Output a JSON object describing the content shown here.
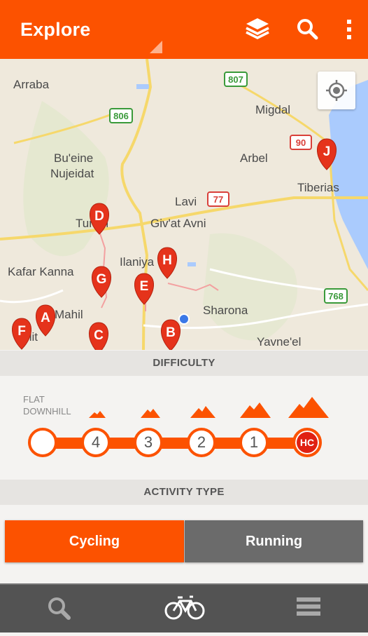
{
  "appbar": {
    "title": "Explore",
    "icons": [
      "layers-icon",
      "search-icon",
      "overflow-menu-icon"
    ],
    "accent": "#fc5200"
  },
  "map": {
    "places": [
      "Arraba",
      "Migdal",
      "Bu'eine",
      "Nujeidat",
      "Arbel",
      "Tiberias",
      "Lavi",
      "Tur'an",
      "Giv'at Avni",
      "Ilaniya",
      "Kafar Kanna",
      "Sharona",
      "Yavne'el",
      "Mahil",
      "Ilit"
    ],
    "road_shields": [
      "807",
      "806",
      "90",
      "77",
      "768"
    ],
    "markers": [
      "A",
      "B",
      "C",
      "D",
      "E",
      "F",
      "G",
      "H",
      "J"
    ]
  },
  "difficulty": {
    "header": "DIFFICULTY",
    "flat_label_line1": "FLAT",
    "flat_label_line2": "DOWNHILL",
    "levels": [
      "",
      "4",
      "3",
      "2",
      "1",
      "HC"
    ],
    "selected": "HC"
  },
  "activity": {
    "header": "ACTIVITY TYPE",
    "cycling": "Cycling",
    "running": "Running",
    "selected": "Cycling"
  },
  "bottom_nav": [
    "search-icon",
    "bike-icon",
    "list-icon"
  ]
}
